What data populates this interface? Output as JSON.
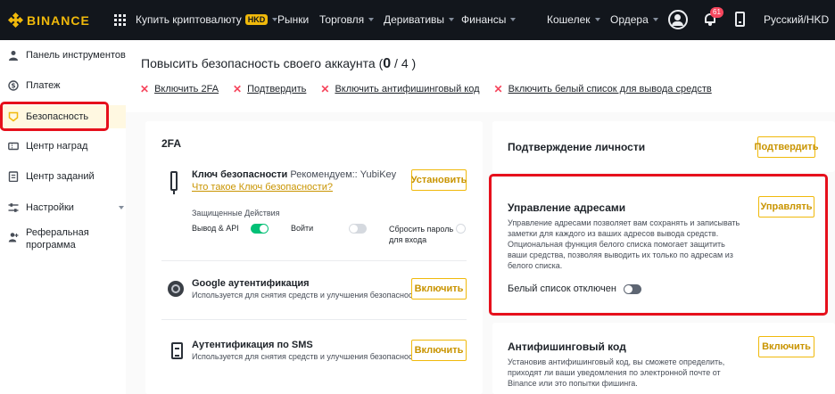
{
  "nav": {
    "logo": "BINANCE",
    "items": [
      {
        "label": "Купить криптовалюту",
        "badge": "HKD",
        "dropdown": true
      },
      {
        "label": "Рынки",
        "dropdown": false
      },
      {
        "label": "Торговля",
        "dropdown": true
      },
      {
        "label": "Деривативы",
        "dropdown": true
      },
      {
        "label": "Финансы",
        "dropdown": true
      }
    ],
    "right": [
      {
        "label": "Кошелек",
        "dropdown": true
      },
      {
        "label": "Ордера",
        "dropdown": true
      }
    ],
    "notification_count": "61",
    "language": "Русский/HKD"
  },
  "sidebar": {
    "items": [
      {
        "label": "Панель инструментов",
        "icon": "user-icon"
      },
      {
        "label": "Платеж",
        "icon": "dollar-icon"
      },
      {
        "label": "Безопасность",
        "icon": "shield-icon",
        "active": true
      },
      {
        "label": "Центр наград",
        "icon": "ticket-icon"
      },
      {
        "label": "Центр заданий",
        "icon": "clipboard-icon"
      },
      {
        "label": "Настройки",
        "icon": "sliders-icon",
        "dropdown": true
      },
      {
        "label": "Реферальная программа",
        "label_line1": "Реферальная",
        "label_line2": "программа",
        "icon": "add-user-icon"
      }
    ]
  },
  "header": {
    "title_prefix": "Повысить безопасность своего аккаунта (",
    "progress_done": "0",
    "progress_sep": " / ",
    "progress_total": "4",
    "title_suffix": " )",
    "steps": [
      "Включить 2FA",
      "Подтвердить",
      "Включить антифишинговый код",
      "Включить белый список для вывода средств"
    ]
  },
  "twofa": {
    "title": "2FA",
    "security_key": {
      "title": "Ключ безопасности",
      "recommend": "Рекомендуем:: YubiKey",
      "link": "Что такое Ключ безопасности?",
      "button": "Установить",
      "protected_label": "Защищенные Действия",
      "actions": [
        {
          "label": "Вывод & API",
          "on": true
        },
        {
          "label": "Войти",
          "on": false
        },
        {
          "label_line1": "Сбросить пароль",
          "label_line2": "для входа",
          "on": false
        }
      ]
    },
    "google": {
      "title": "Google аутентификация",
      "desc": "Используется для снятия средств и улучшения безопасности",
      "button": "Включить"
    },
    "sms": {
      "title": "Аутентификация по SMS",
      "desc": "Используется для снятия средств и улучшения безопасности",
      "button": "Включить"
    }
  },
  "identity": {
    "title": "Подтверждение личности",
    "button": "Подтвердить"
  },
  "address": {
    "title": "Управление адресами",
    "desc_lines": [
      "Управление адресами позволяет вам сохранять и записывать",
      "заметки для каждого из ваших адресов вывода средств.",
      "Опциональная функция белого списка помогает защитить",
      "ваши средства, позволяя выводить их только по адресам из",
      "белого списка."
    ],
    "button": "Управлять",
    "whitelist_label": "Белый список отключен",
    "whitelist_on": false
  },
  "antiphishing": {
    "title": "Антифишинговый код",
    "desc_lines": [
      "Установив антифишинговый код, вы сможете определить,",
      "приходят ли ваши уведомления по электронной почте от",
      "Binance или это попытки фишинга."
    ],
    "button": "Включить"
  },
  "colors": {
    "brand": "#f0b90b",
    "nav_bg": "#12161c",
    "highlight": "#e6101c",
    "toggle_on": "#02c076"
  }
}
